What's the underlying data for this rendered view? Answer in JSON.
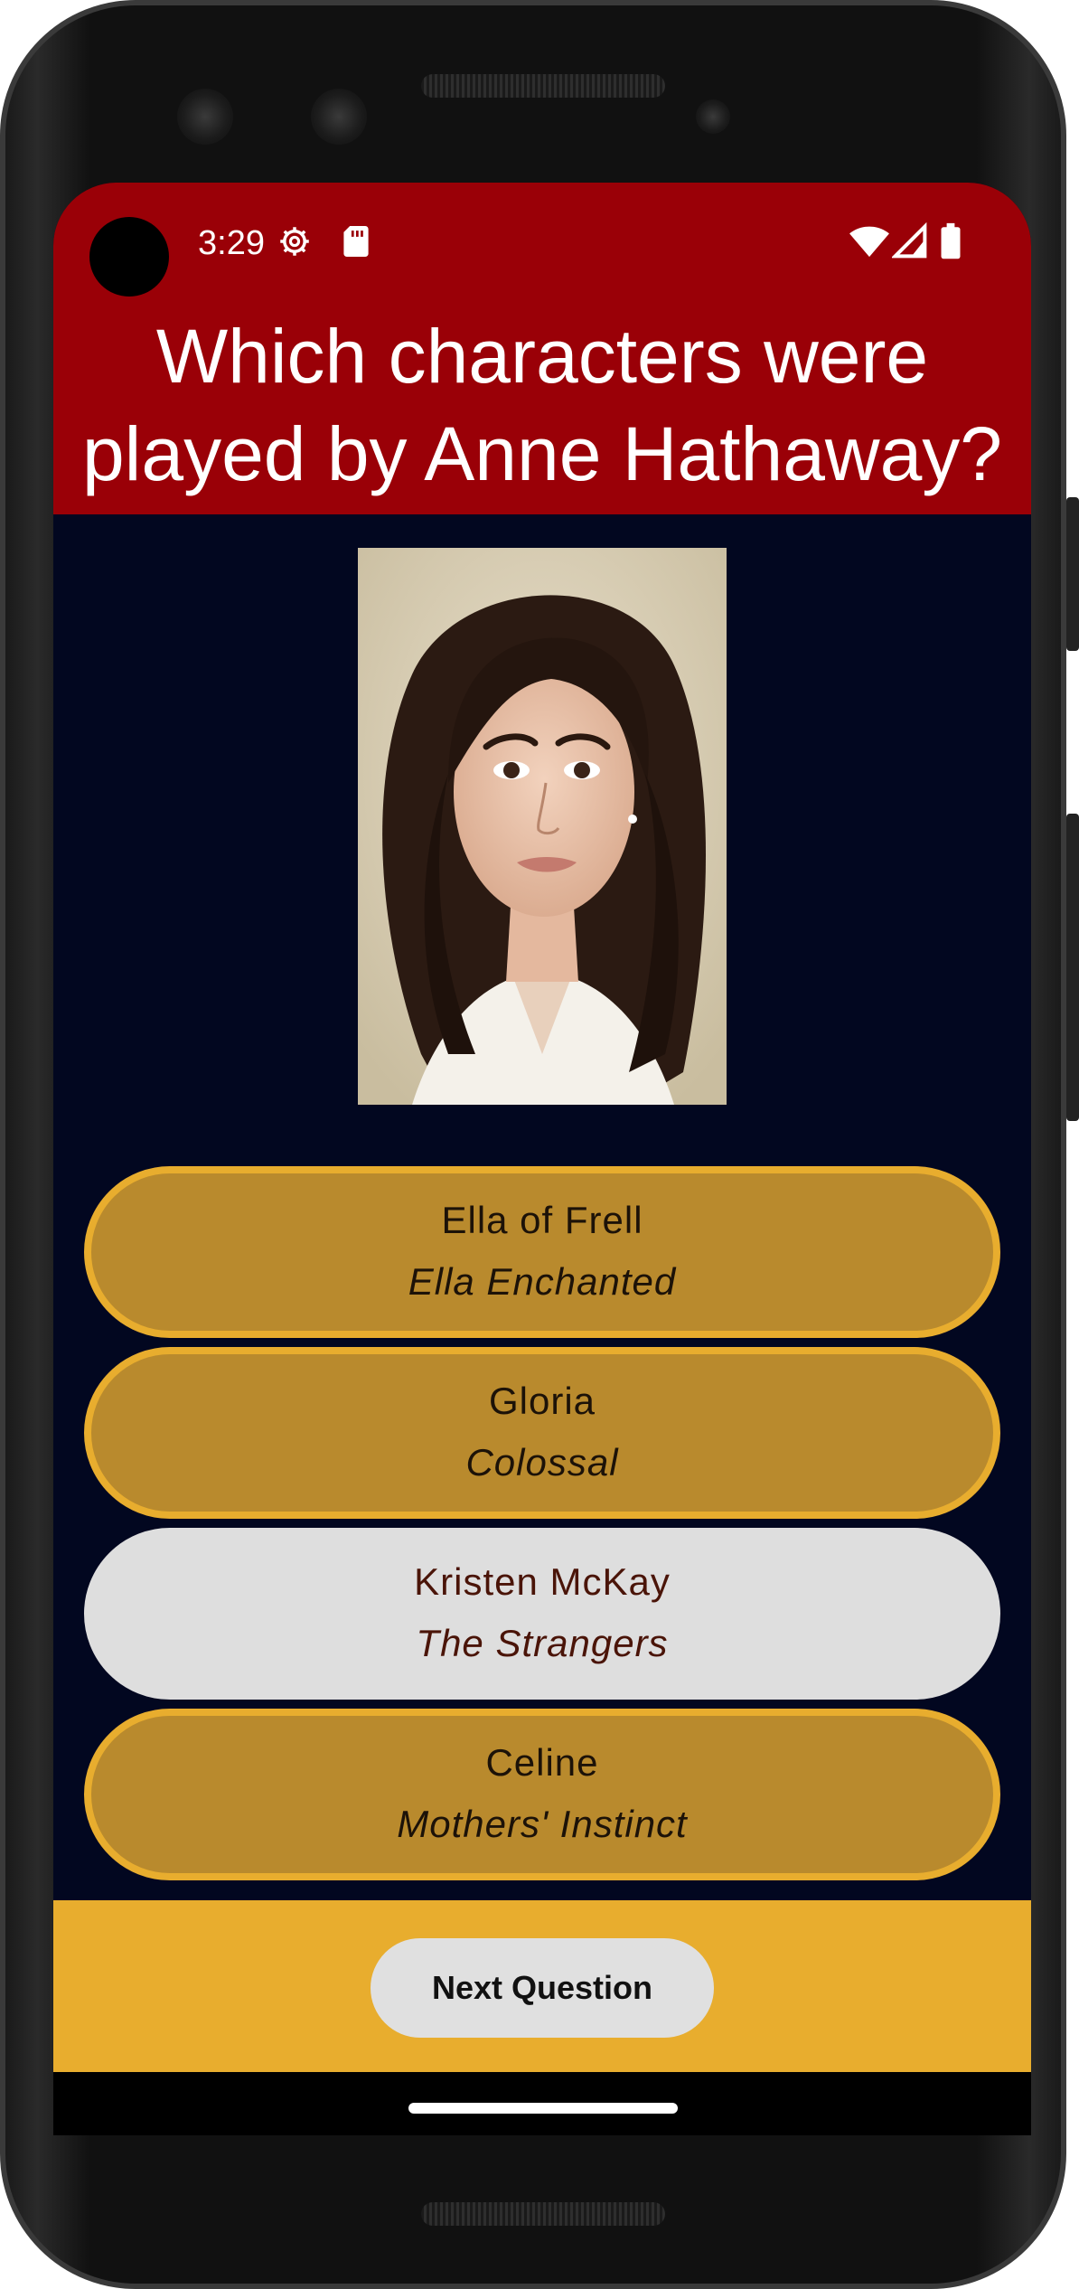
{
  "status_bar": {
    "time": "3:29",
    "icons": [
      "settings-gear-icon",
      "sd-card-icon",
      "wifi-icon",
      "cell-signal-icon",
      "battery-icon"
    ]
  },
  "quiz": {
    "question": "Which characters were played by Anne Hathaway?",
    "image_alt": "Anne Hathaway portrait",
    "answers": [
      {
        "name": "Ella of Frell",
        "movie": "Ella Enchanted",
        "state": "default"
      },
      {
        "name": "Gloria",
        "movie": "Colossal",
        "state": "default"
      },
      {
        "name": "Kristen McKay",
        "movie": "The Strangers",
        "state": "selected"
      },
      {
        "name": "Celine",
        "movie": "Mothers' Instinct",
        "state": "default"
      }
    ],
    "next_label": "Next Question"
  },
  "colors": {
    "header": "#9a0007",
    "background": "#020720",
    "answer_fill": "#b98a2d",
    "answer_border": "#e8ad2e",
    "answer_selected": "#dedede",
    "footer": "#e8ad2e"
  }
}
